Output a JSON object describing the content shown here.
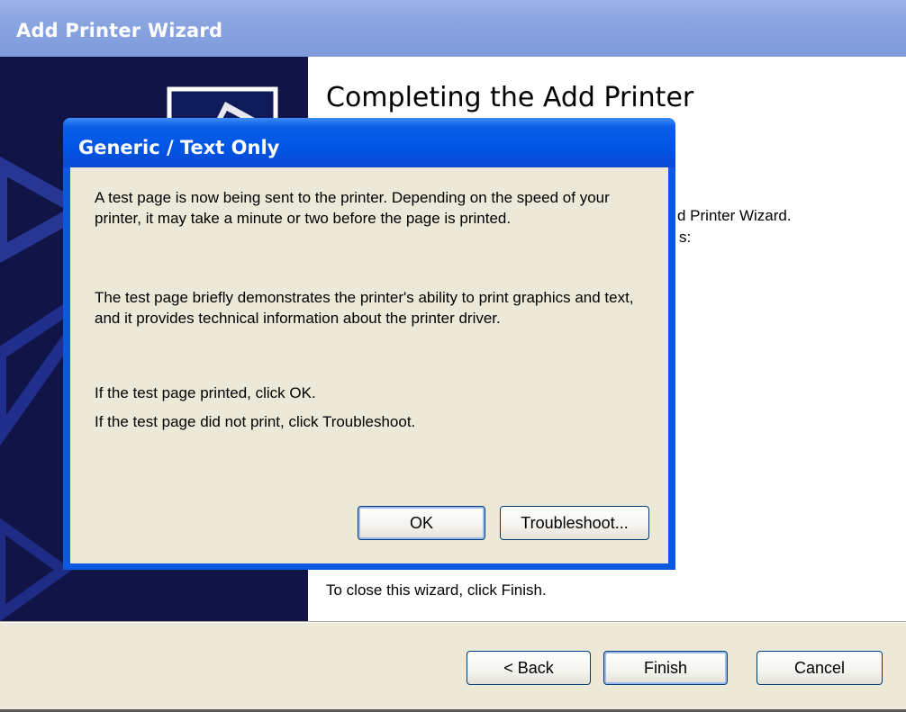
{
  "wizard": {
    "title": "Add Printer Wizard",
    "heading": "Completing the Add Printer",
    "partial_line1": "d Printer Wizard.",
    "partial_line2": "s:",
    "close_text": "To close this wizard, click Finish.",
    "buttons": {
      "back": "< Back",
      "finish": "Finish",
      "cancel": "Cancel"
    }
  },
  "dialog": {
    "title": "Generic / Text Only",
    "paragraph1": "A test page is now being sent to the printer. Depending on the speed of your printer, it may take a minute or two before the page is printed.",
    "paragraph2": "The test page briefly demonstrates the printer's ability to print graphics and text, and it provides technical information about the printer driver.",
    "line_ok": "If the test page printed, click OK.",
    "line_troubleshoot": "If the test page did not print, click Troubleshoot.",
    "buttons": {
      "ok": "OK",
      "troubleshoot": "Troubleshoot..."
    }
  },
  "colors": {
    "xp_title_blue": "#0055e5",
    "wizard_title_inactive": "#8aa4e0",
    "window_face": "#ece9d8",
    "sidebar_navy": "#0d1040"
  }
}
